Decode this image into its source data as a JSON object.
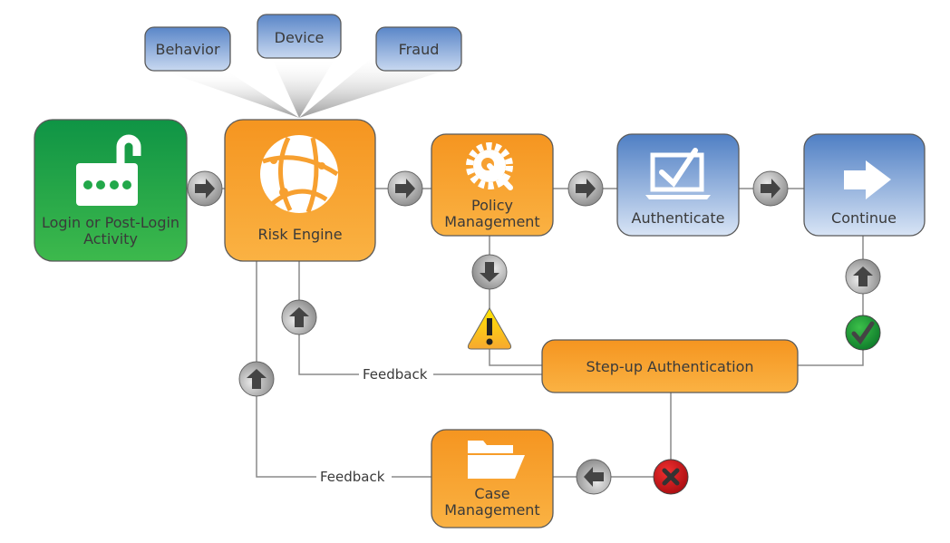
{
  "inputs": {
    "behavior": "Behavior",
    "device": "Device",
    "fraud": "Fraud"
  },
  "nodes": {
    "login": {
      "line1": "Login or Post-Login",
      "line2": "Activity",
      "icon": "unlocked-padlock-icon"
    },
    "risk_engine": {
      "label": "Risk Engine",
      "icon": "globe-network-icon"
    },
    "policy": {
      "line1": "Policy",
      "line2": "Management",
      "icon": "gear-wrench-icon"
    },
    "authenticate": {
      "label": "Authenticate",
      "icon": "laptop-check-icon"
    },
    "continue": {
      "label": "Continue",
      "icon": "right-arrow-icon"
    },
    "stepup": {
      "label": "Step-up Authentication"
    },
    "case": {
      "line1": "Case",
      "line2": "Management",
      "icon": "folder-icon"
    }
  },
  "feedback": {
    "upper": "Feedback",
    "lower": "Feedback"
  },
  "colors": {
    "green": "#22a84a",
    "orange": "#f7a030",
    "blue": "#6f96cf",
    "connector": "#8a8a8a"
  }
}
